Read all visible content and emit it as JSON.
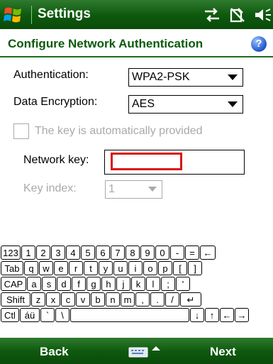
{
  "titlebar": {
    "title": "Settings",
    "icons": [
      "connectivity-icon",
      "sync-icon",
      "volume-icon"
    ]
  },
  "header": {
    "title": "Configure Network Authentication",
    "help": "?"
  },
  "form": {
    "authentication_label": "Authentication:",
    "authentication_value": "WPA2-PSK",
    "encryption_label": "Data Encryption:",
    "encryption_value": "AES",
    "auto_key_label": "The key is automatically provided",
    "auto_key_checked": false,
    "network_key_label": "Network key:",
    "network_key_value": "",
    "key_index_label": "Key index:",
    "key_index_value": "1"
  },
  "keyboard": {
    "rows": [
      [
        "123",
        "1",
        "2",
        "3",
        "4",
        "5",
        "6",
        "7",
        "8",
        "9",
        "0",
        "-",
        "=",
        "←"
      ],
      [
        "Tab",
        "q",
        "w",
        "e",
        "r",
        "t",
        "y",
        "u",
        "i",
        "o",
        "p",
        "[",
        "]"
      ],
      [
        "CAP",
        "a",
        "s",
        "d",
        "f",
        "g",
        "h",
        "j",
        "k",
        "l",
        ";",
        "'"
      ],
      [
        "Shift",
        "z",
        "x",
        "c",
        "v",
        "b",
        "n",
        "m",
        ",",
        ".",
        "/",
        "↵"
      ],
      [
        "Ctl",
        "áü",
        "`",
        "\\",
        " ",
        "↓",
        "↑",
        "←",
        "→"
      ]
    ]
  },
  "softkeys": {
    "left": "Back",
    "right": "Next"
  },
  "colors": {
    "bar_green": "#0e5a0e",
    "title_green": "#0b5a0b",
    "focus_red": "#d91414"
  }
}
